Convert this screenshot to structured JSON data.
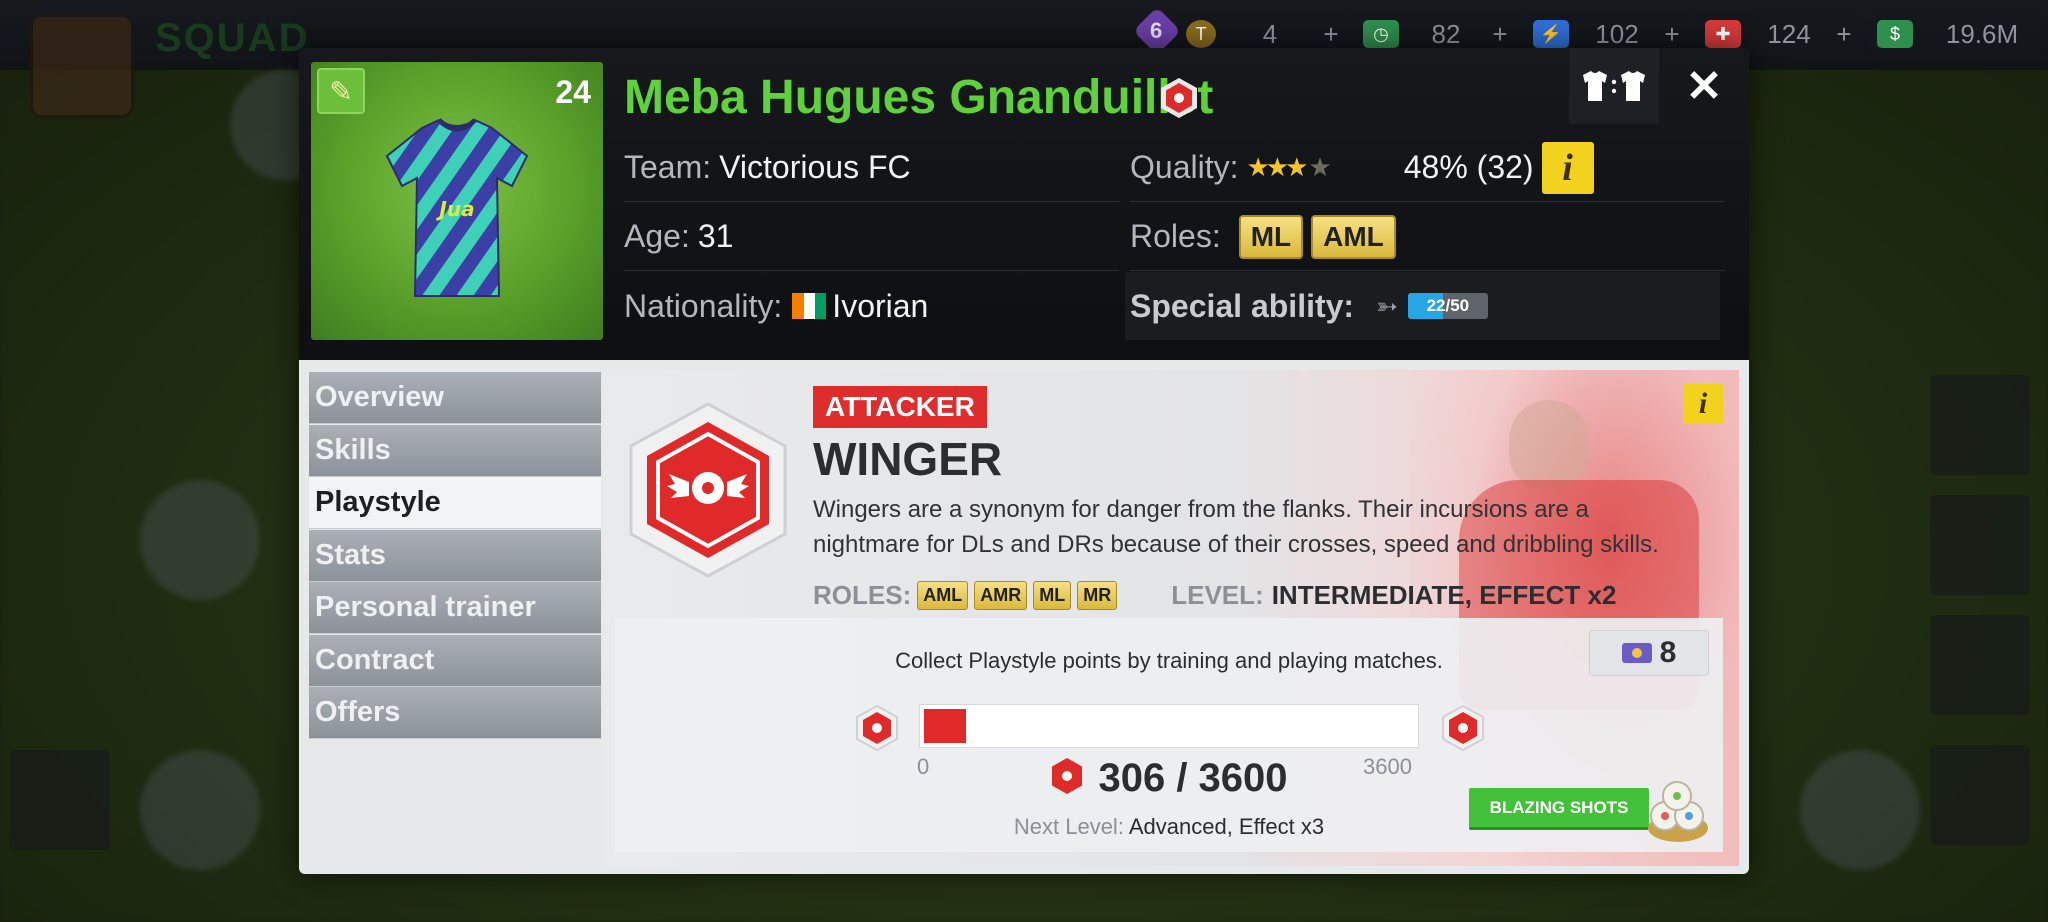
{
  "topbar": {
    "currencies": [
      {
        "name": "tokens",
        "value": "4",
        "color": "#8a6b1e"
      },
      {
        "name": "cash",
        "value": "82",
        "color": "#2f8f4e"
      },
      {
        "name": "energy",
        "value": "102",
        "color": "#2f6fd8"
      },
      {
        "name": "health",
        "value": "124",
        "color": "#d63a3a"
      },
      {
        "name": "money",
        "value": "19.6M",
        "color": "#2f8f4e"
      }
    ],
    "gem_count": "6",
    "plus_label": "+"
  },
  "background": {
    "squad_label": "SQUAD"
  },
  "player": {
    "kit_number": "24",
    "name": "Meba Hugues Gnanduillet",
    "team_label": "Team:",
    "team": "Victorious FC",
    "age_label": "Age:",
    "age": "31",
    "nationality_label": "Nationality:",
    "nationality": "Ivorian",
    "quality_label": "Quality:",
    "quality_stars": 3.5,
    "quality_value": "48% (32)",
    "roles_label": "Roles:",
    "roles": [
      "ML",
      "AML"
    ],
    "special_ability_label": "Special ability:",
    "special_ability_progress": "22/50",
    "special_ability_fraction": 0.44,
    "kit_swap_label": "T:T",
    "info_label": "i"
  },
  "sidebar": {
    "items": [
      {
        "label": "Overview",
        "active": false
      },
      {
        "label": "Skills",
        "active": false
      },
      {
        "label": "Playstyle",
        "active": true
      },
      {
        "label": "Stats",
        "active": false
      },
      {
        "label": "Personal trainer",
        "active": false
      },
      {
        "label": "Contract",
        "active": false
      },
      {
        "label": "Offers",
        "active": false
      }
    ]
  },
  "playstyle": {
    "category": "ATTACKER",
    "title": "WINGER",
    "description": "Wingers are a synonym for danger from the flanks. Their incursions are a nightmare for DLs and DRs because of their crosses, speed and dribbling skills.",
    "roles_label": "ROLES:",
    "roles": [
      "AML",
      "AMR",
      "ML",
      "MR"
    ],
    "level_label": "LEVEL:",
    "level_value": "INTERMEDIATE, EFFECT x2",
    "collect_text": "Collect Playstyle points by training and playing matches.",
    "points_available": "8",
    "progress_current": 306,
    "progress_max": 3600,
    "progress_min_label": "0",
    "progress_max_label": "3600",
    "progress_text": "306 / 3600",
    "next_level_label": "Next Level:",
    "next_level_value": "Advanced, Effect x3",
    "boost_button": "BLAZING SHOTS"
  },
  "colors": {
    "name_green": "#5fd13a",
    "accent_red": "#df2d2d",
    "role_yellow": "#e8c94f",
    "button_green": "#44c13a"
  }
}
